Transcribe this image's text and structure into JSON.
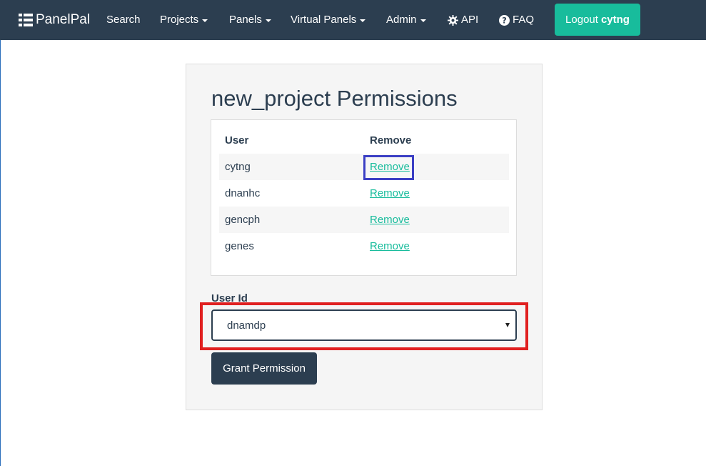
{
  "navbar": {
    "brand": "PanelPal",
    "items": [
      {
        "label": "Search",
        "dropdown": false
      },
      {
        "label": "Projects",
        "dropdown": true
      },
      {
        "label": "Panels",
        "dropdown": true
      },
      {
        "label": "Virtual Panels",
        "dropdown": true
      },
      {
        "label": "Admin",
        "dropdown": true
      },
      {
        "label": "API",
        "icon": "gear-icon"
      },
      {
        "label": "FAQ",
        "icon": "question-circle-icon"
      }
    ],
    "logout": {
      "prefix": "Logout",
      "username": "cytng"
    }
  },
  "main": {
    "title": "new_project Permissions",
    "table": {
      "headers": [
        "User",
        "Remove"
      ],
      "rows": [
        {
          "user": "cytng",
          "action": "Remove"
        },
        {
          "user": "dnanhc",
          "action": "Remove"
        },
        {
          "user": "gencph",
          "action": "Remove"
        },
        {
          "user": "genes",
          "action": "Remove"
        }
      ]
    },
    "form": {
      "label": "User Id",
      "selected": "dnamdp",
      "submit": "Grant Permission"
    }
  },
  "colors": {
    "navbar": "#2c3e50",
    "accent": "#18bc9c",
    "highlight_blue": "#3b3fc4",
    "highlight_red": "#e02020"
  }
}
